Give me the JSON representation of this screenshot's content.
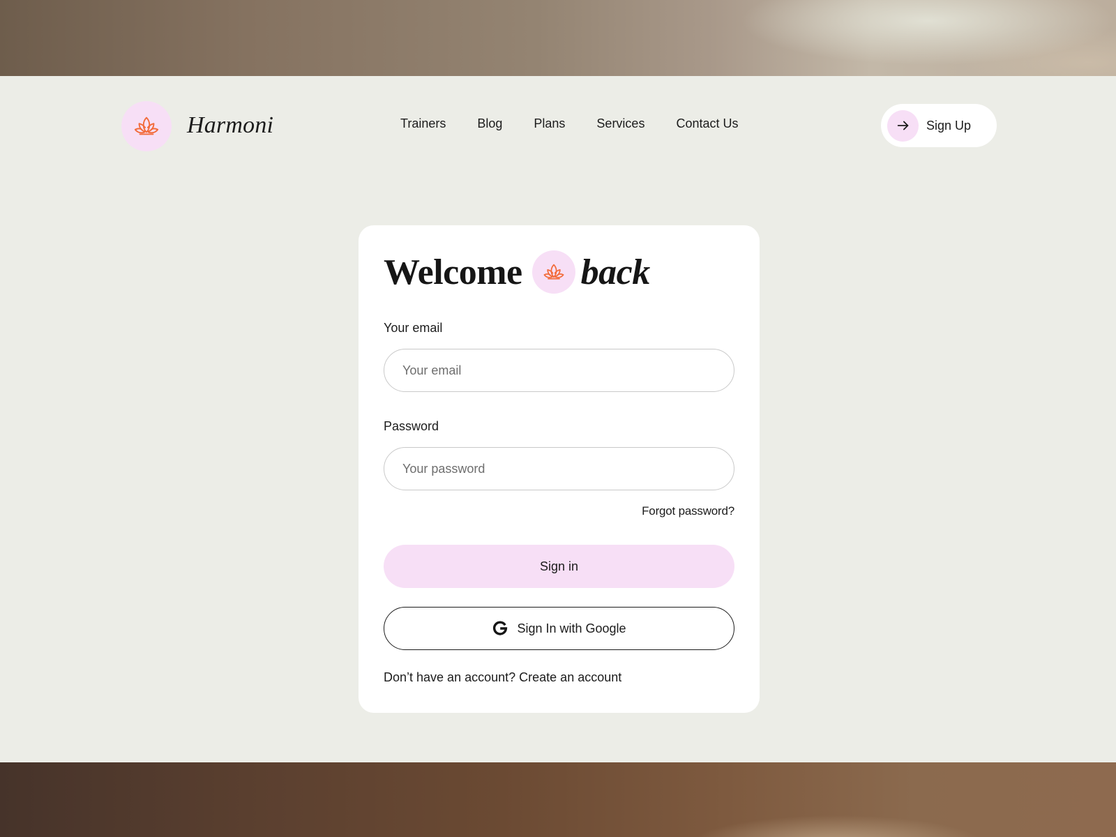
{
  "brand": {
    "name": "Harmoni",
    "logo_icon": "lotus-icon",
    "accent_color": "#f26b3a",
    "badge_color": "#f7dff6"
  },
  "nav": {
    "items": [
      {
        "label": "Trainers"
      },
      {
        "label": "Blog"
      },
      {
        "label": "Plans"
      },
      {
        "label": "Services"
      },
      {
        "label": "Contact Us"
      }
    ]
  },
  "header": {
    "signup_label": "Sign Up",
    "signup_icon": "arrow-right-icon"
  },
  "login": {
    "title_part1": "Welcome",
    "title_part2": "back",
    "email_label": "Your email",
    "email_placeholder": "Your email",
    "email_value": "",
    "password_label": "Password",
    "password_placeholder": "Your password",
    "password_value": "",
    "forgot_label": "Forgot password?",
    "signin_label": "Sign in",
    "google_label": "Sign In with Google",
    "google_icon": "google-icon",
    "no_account_text": "Don’t have an account?",
    "create_account_label": "Create an account"
  }
}
